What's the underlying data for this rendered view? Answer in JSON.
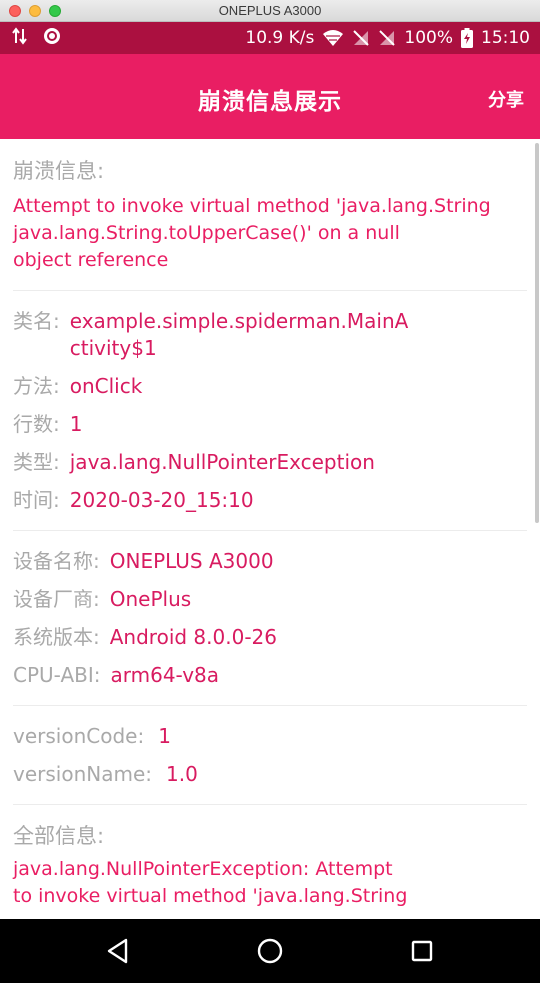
{
  "window": {
    "title": "ONEPLUS A3000"
  },
  "status_bar": {
    "left_icons": [
      "data-arrows-icon",
      "record-icon"
    ],
    "speed": "10.9 K/s",
    "battery": "100%",
    "time": "15:10"
  },
  "app_bar": {
    "title": "崩溃信息展示",
    "share_label": "分享"
  },
  "crash": {
    "heading": "崩溃信息:",
    "message_lines": [
      "Attempt to invoke virtual method 'java.lang.String",
      "java.lang.String.toUpperCase()' on a null",
      "object reference"
    ]
  },
  "details": [
    {
      "key": "类名:",
      "value_lines": [
        "example.simple.spiderman.MainA",
        "ctivity$1"
      ]
    },
    {
      "key": "方法:",
      "value_lines": [
        "onClick"
      ]
    },
    {
      "key": "行数:",
      "value_lines": [
        "1"
      ]
    },
    {
      "key": "类型:",
      "value_lines": [
        "java.lang.NullPointerException"
      ]
    },
    {
      "key": "时间:",
      "value_lines": [
        "2020-03-20_15:10"
      ]
    }
  ],
  "device": [
    {
      "key": "设备名称:",
      "value": "ONEPLUS A3000"
    },
    {
      "key": "设备厂商:",
      "value": "OnePlus"
    },
    {
      "key": "系统版本:",
      "value": "Android 8.0.0-26"
    },
    {
      "key": "CPU-ABI:",
      "value": "arm64-v8a"
    }
  ],
  "version": [
    {
      "key": "versionCode:",
      "value": "1"
    },
    {
      "key": "versionName:",
      "value": "1.0"
    }
  ],
  "full": {
    "heading": "全部信息:",
    "lines": [
      "java.lang.NullPointerException: Attempt",
      "to invoke virtual method 'java.lang.String"
    ]
  },
  "colors": {
    "status_bar": "#ab1040",
    "app_bar": "#e91e63",
    "value_text": "#d81b60",
    "label_text": "#a9a9a9"
  },
  "nav_icons": [
    "back-icon",
    "home-icon",
    "recents-icon"
  ]
}
